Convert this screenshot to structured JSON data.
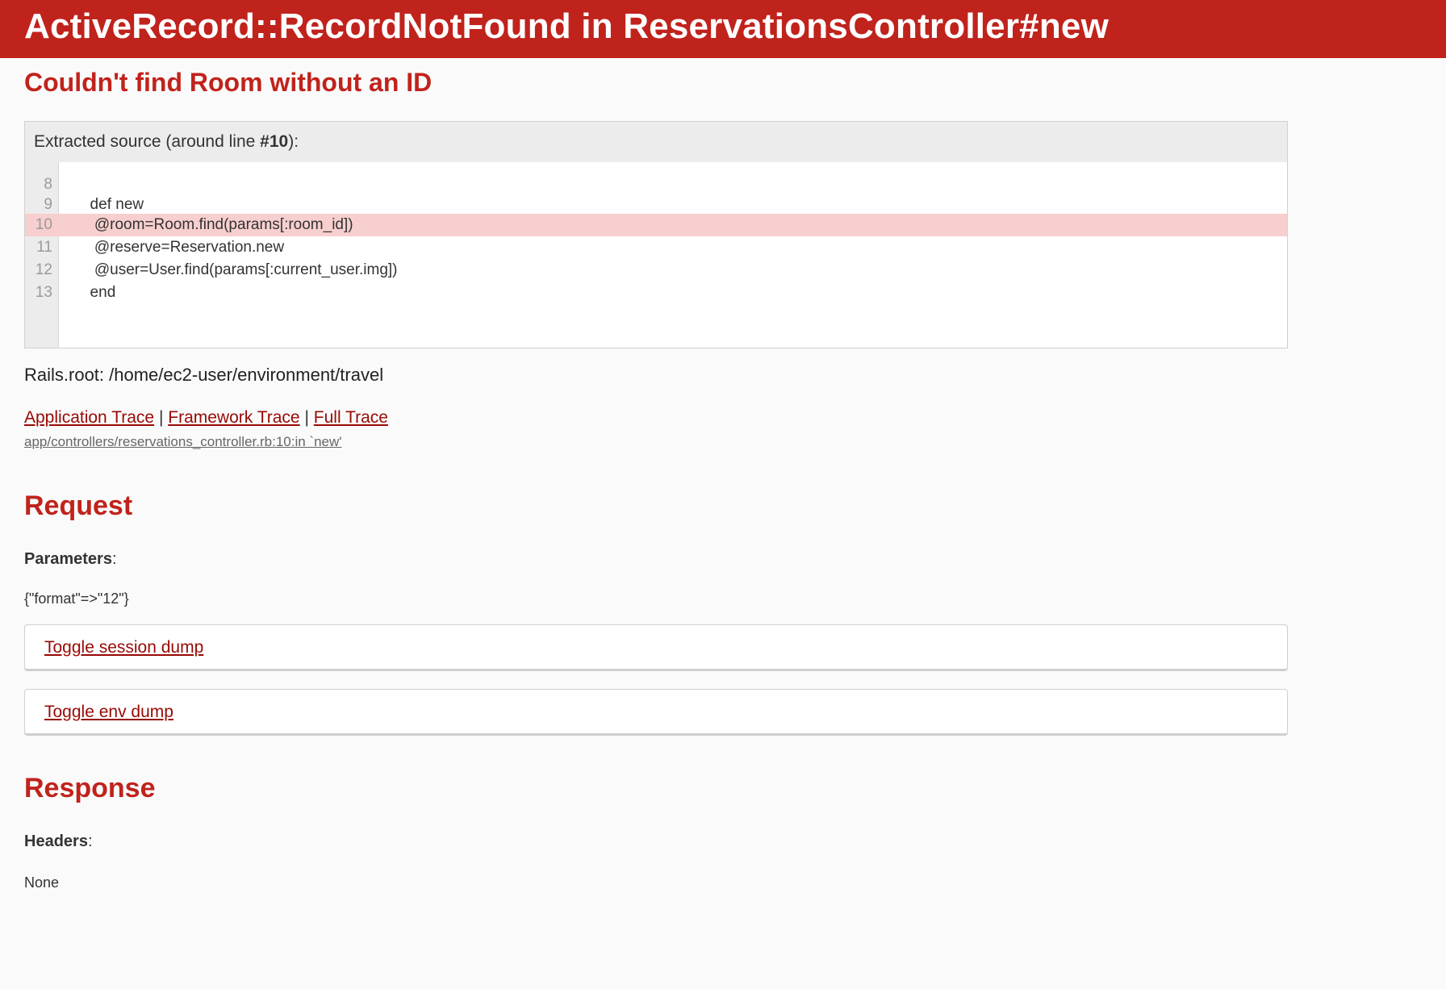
{
  "header": {
    "title": "ActiveRecord::RecordNotFound in ReservationsController#new"
  },
  "error": {
    "message": "Couldn't find Room without an ID"
  },
  "source": {
    "header_prefix": "Extracted source (around line ",
    "header_line": "#10",
    "header_suffix": "):",
    "lines": [
      {
        "num": "8",
        "code": ""
      },
      {
        "num": "9",
        "code": "  def new"
      },
      {
        "num": "10",
        "code": "   @room=Room.find(params[:room_id])"
      },
      {
        "num": "11",
        "code": "   @reserve=Reservation.new"
      },
      {
        "num": "12",
        "code": "   @user=User.find(params[:current_user.img])"
      },
      {
        "num": "13",
        "code": "  end"
      }
    ],
    "highlight_line": "10"
  },
  "rails_root": "Rails.root: /home/ec2-user/environment/travel",
  "traces": {
    "application": "Application Trace",
    "separator": "|",
    "framework": "Framework Trace",
    "full": "Full Trace",
    "trace_line": "app/controllers/reservations_controller.rb:10:in `new'"
  },
  "request": {
    "heading": "Request",
    "params_label": "Parameters",
    "params_colon": ":",
    "params_value": "{\"format\"=>\"12\"}",
    "toggle_session": "Toggle session dump",
    "toggle_env": "Toggle env dump"
  },
  "response": {
    "heading": "Response",
    "headers_label": "Headers",
    "headers_colon": ":",
    "headers_value": "None"
  },
  "colors": {
    "accent": "#c0231c",
    "link": "#980905",
    "highlight": "#f7cfce"
  }
}
